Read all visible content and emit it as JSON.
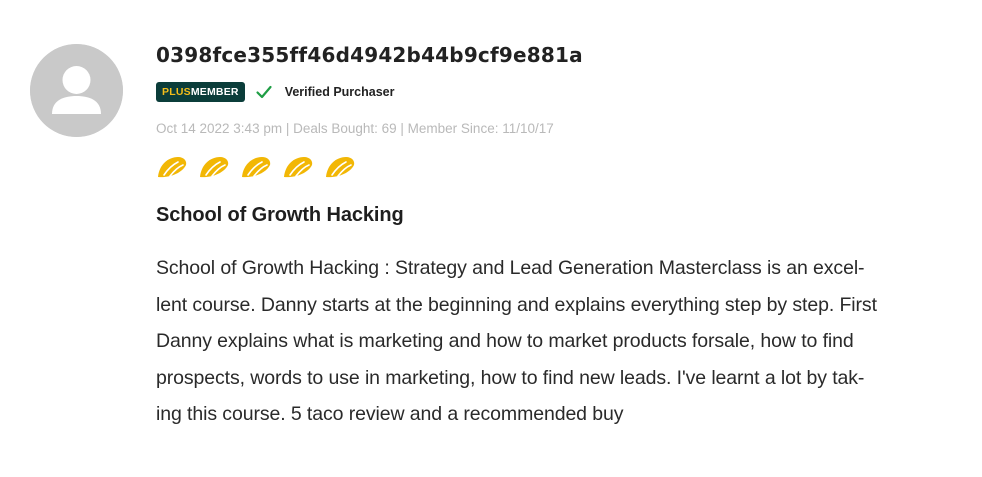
{
  "review": {
    "username": "0398fce355ff46d4942b44b9cf9e881a",
    "badge": {
      "prefix": "PLUS",
      "suffix": "MEMBER"
    },
    "verified_label": "Verified Purchaser",
    "meta": "Oct 14 2022 3:43 pm | Deals Bought: 69 | Member Since: 11/10/17",
    "rating": {
      "value": 5,
      "max": 5,
      "icon": "taco-icon",
      "color": "#f2b705"
    },
    "title": "School of Growth Hacking",
    "body": "School of Growth Hacking : Strategy and Lead Generation Masterclass is an excel-\nlent course. Danny starts at the beginning and explains everything step by step. First\nDanny explains what is marketing and how to market products forsale, how to find\nprospects, words to use in marketing, how to find new leads. I've learnt a lot by tak-\ning this course. 5 taco review and a recommended buy"
  },
  "colors": {
    "badge_bg": "#0b3d3a",
    "badge_plus": "#f4bd1a",
    "check": "#1f9e45",
    "avatar_bg": "#c9c9c9",
    "meta_text": "#b9b9b9"
  }
}
